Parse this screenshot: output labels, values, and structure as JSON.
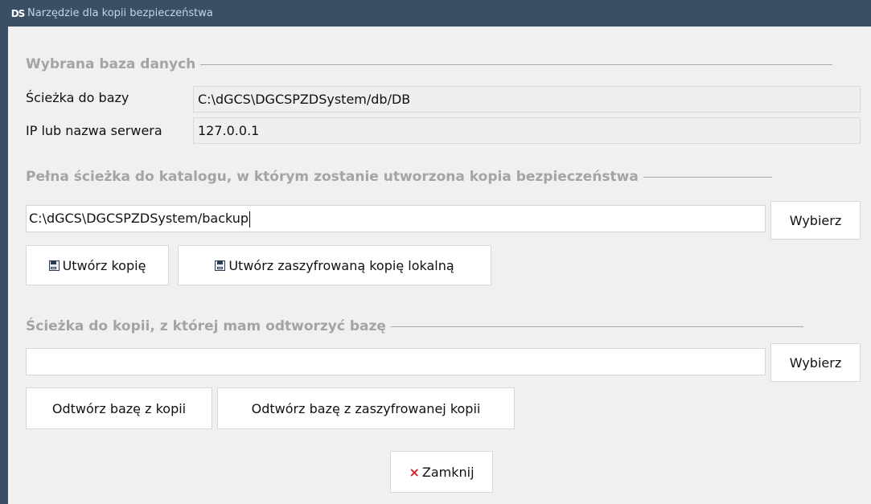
{
  "window": {
    "title": "Narzędzie dla kopii bezpieczeństwa",
    "icon_text": "DS"
  },
  "database": {
    "section_title": "Wybrana baza danych",
    "path_label": "Ścieżka do bazy",
    "path_value": "C:\\dGCS\\DGCSPZDSystem/db/DB",
    "server_label": "IP lub nazwa serwera",
    "server_value": "127.0.0.1"
  },
  "backup": {
    "section_title": "Pełna ścieżka do katalogu, w którym zostanie utworzona kopia bezpieczeństwa",
    "path_value": "C:\\dGCS\\DGCSPZDSystem/backup",
    "choose_label": "Wybierz",
    "create_label": "Utwórz kopię",
    "create_encrypted_label": "Utwórz zaszyfrowaną kopię lokalną"
  },
  "restore": {
    "section_title": "Ścieżka do kopii, z której mam odtworzyć bazę",
    "path_value": "",
    "choose_label": "Wybierz",
    "restore_label": "Odtwórz bazę z kopii",
    "restore_encrypted_label": "Odtwórz bazę z zaszyfrowanej kopii"
  },
  "footer": {
    "close_label": "Zamknij"
  },
  "colors": {
    "titlebar": "#3a4f66",
    "section_title": "#a4a4a4",
    "close_x": "#d62020"
  }
}
